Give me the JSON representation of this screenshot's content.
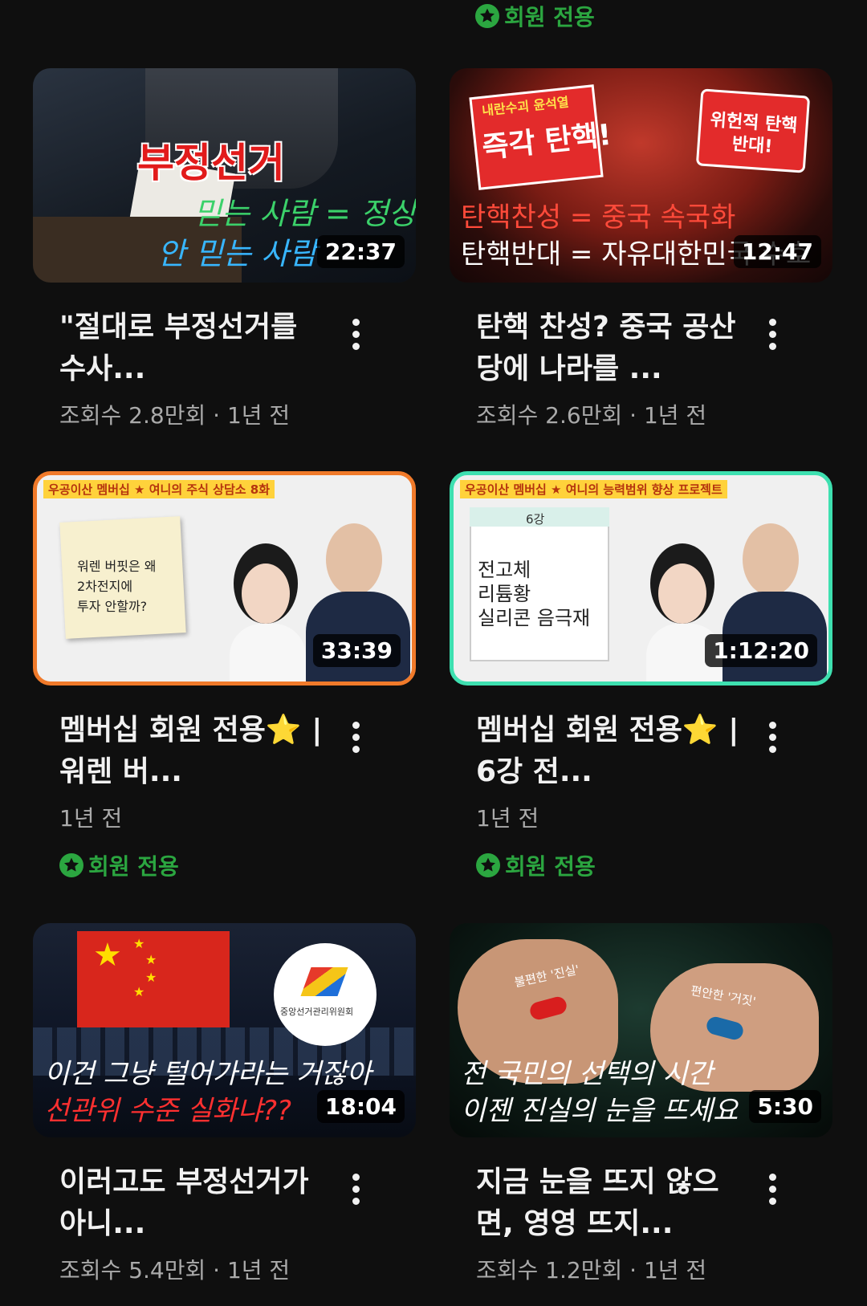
{
  "top_badge": "회원 전용",
  "videos": [
    {
      "title": "\"절대로 부정선거를 수사...",
      "views": "조회수 2.8만회",
      "age": "1년 전",
      "duration": "22:37",
      "overlay": [
        "부정선거",
        "믿는 사람 = 정상",
        "안 믿는 사람"
      ]
    },
    {
      "title": "탄핵 찬성? 중국 공산당에 나라를 ...",
      "views": "조회수 2.6만회",
      "age": "1년 전",
      "duration": "12:47",
      "overlay": [
        "내란수괴 윤석열",
        "즉각 탄핵!",
        "위헌적 탄핵 반대!",
        "탄핵찬성 = 중국 속국화",
        "탄핵반대 = 자유대한민국 수호"
      ]
    },
    {
      "title": "멤버십 회원 전용⭐ | 워렌 버...",
      "age": "1년 전",
      "duration": "33:39",
      "badge": "회원 전용",
      "overlay": [
        "우공이산 멤버십 ★ 여니의 주식 상담소 8화",
        "워렌 버핏은 왜",
        "2차전지에",
        "투자 안할까?"
      ]
    },
    {
      "title": "멤버십 회원 전용⭐ | 6강 전...",
      "age": "1년 전",
      "duration": "1:12:20",
      "badge": "회원 전용",
      "overlay": [
        "우공이산 멤버십 ★ 여니의 능력범위 향상 프로젝트",
        "6강",
        "전고체",
        "리튬황",
        "실리콘 음극재"
      ]
    },
    {
      "title": "이러고도 부정선거가 아니...",
      "views": "조회수 5.4만회",
      "age": "1년 전",
      "duration": "18:04",
      "overlay": [
        "중앙선거관리위원회",
        "이건 그냥 털어가라는 거잖아",
        "선관위 수준 실화냐??"
      ]
    },
    {
      "title": "지금 눈을 뜨지 않으면, 영영 뜨지...",
      "views": "조회수 1.2만회",
      "age": "1년 전",
      "duration": "5:30",
      "overlay": [
        "불편한 '진실'",
        "편안한 '거짓'",
        "전 국민의 선택의 시간",
        "이젠 진실의 눈을 뜨세요"
      ]
    }
  ],
  "colors": {
    "member_green": "#2ba640",
    "bg": "#0f0f0f",
    "meta_gray": "#aaaaaa"
  },
  "icons": {
    "badge": "star-circle-icon",
    "more": "more-vert-icon"
  }
}
